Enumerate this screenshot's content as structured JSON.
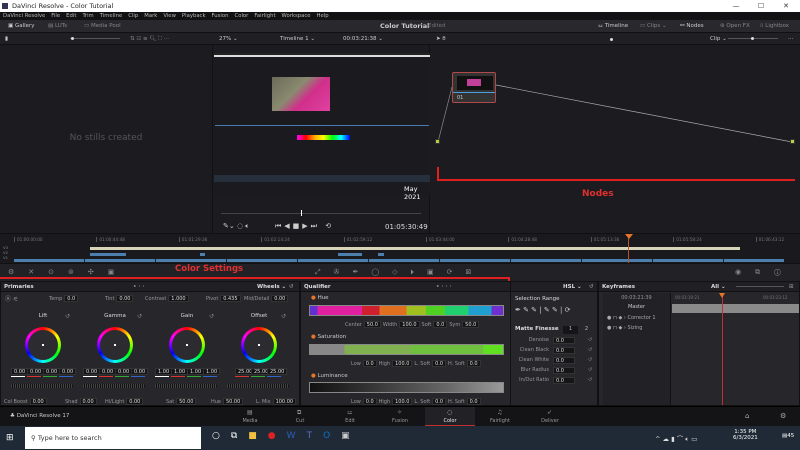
{
  "window": {
    "title": "DaVinci Resolve - Color Tutorial",
    "minimize": "—",
    "maximize": "☐",
    "close": "✕"
  },
  "menu": [
    "DaVinci Resolve",
    "File",
    "Edit",
    "Trim",
    "Timeline",
    "Clip",
    "Mark",
    "View",
    "Playback",
    "Fusion",
    "Color",
    "Fairlight",
    "Workspace",
    "Help"
  ],
  "toolbar": {
    "gallery": "Gallery",
    "luts": "LUTs",
    "media_pool": "Media Pool",
    "project": "Color Tutorial",
    "status": "Edited",
    "timeline": "Timeline",
    "clips": "Clips",
    "nodes": "Nodes",
    "openfx": "Open FX",
    "lightbox": "Lightbox"
  },
  "viewer": {
    "zoom": "27%",
    "timeline_name": "Timeline 1",
    "timecode": "00:03:21:38",
    "playhead_tc": "01:05:30:49",
    "overlay_date": "May 2021"
  },
  "nodes_bar": {
    "mode": "Clip"
  },
  "gallery": {
    "empty": "No stills created"
  },
  "node": {
    "label": "01"
  },
  "annotations": {
    "nodes": "Nodes",
    "color_settings": "Color Settings"
  },
  "timeline": {
    "ruler": [
      "01:00:00:00",
      "01:00:44:48",
      "01:01:29:36",
      "01:02:14:24",
      "01:02:59:12",
      "01:03:44:00",
      "01:04:28:48",
      "01:05:13:36",
      "01:05:58:24",
      "01:06:43:12"
    ],
    "tracks": [
      "V3",
      "V2",
      "V1"
    ]
  },
  "primaries": {
    "title": "Primaries",
    "mode": "Wheels",
    "temp_label": "Temp",
    "temp": "0.0",
    "tint_label": "Tint",
    "tint": "0.00",
    "contrast_label": "Contrast",
    "contrast": "1.000",
    "pivot_label": "Pivot",
    "pivot": "0.435",
    "md_label": "Mid/Detail",
    "md": "0.00",
    "wheels": [
      {
        "name": "Lift",
        "vals": [
          "0.00",
          "0.00",
          "0.00",
          "0.00"
        ]
      },
      {
        "name": "Gamma",
        "vals": [
          "0.00",
          "0.00",
          "0.00",
          "0.00"
        ]
      },
      {
        "name": "Gain",
        "vals": [
          "1.00",
          "1.00",
          "1.00",
          "1.00"
        ]
      },
      {
        "name": "Offset",
        "vals": [
          "25.00",
          "25.00",
          "25.00"
        ]
      }
    ],
    "colboost_label": "Col Boost",
    "colboost": "0.00",
    "shad_label": "Shad",
    "shad": "0.00",
    "hl_label": "Hi/Light",
    "hl": "0.00",
    "sat_label": "Sat",
    "sat": "50.00",
    "hue_label": "Hue",
    "hue": "50.00",
    "lmix_label": "L. Mix",
    "lmix": "100.00"
  },
  "qualifier": {
    "title": "Qualifier",
    "mode": "HSL",
    "hue": "Hue",
    "center_label": "Center",
    "center": "50.0",
    "width_label": "Width",
    "width": "100.0",
    "soft_label": "Soft",
    "soft": "0.0",
    "sym_label": "Sym",
    "sym": "50.0",
    "saturation": "Saturation",
    "luminance": "Luminance",
    "low_label": "Low",
    "low": "0.0",
    "high_label": "High",
    "high": "100.0",
    "lsoft_label": "L. Soft",
    "lsoft": "0.0",
    "hsoft_label": "H. Soft",
    "hsoft": "0.0"
  },
  "selection": {
    "title": "Selection Range",
    "matte": "Matte Finesse",
    "tab1": "1",
    "tab2": "2",
    "rows": [
      {
        "label": "Denoise",
        "value": "0.0"
      },
      {
        "label": "Clean Black",
        "value": "0.0"
      },
      {
        "label": "Clean White",
        "value": "0.0"
      },
      {
        "label": "Blur Radius",
        "value": "0.0"
      },
      {
        "label": "In/Out Ratio",
        "value": "0.0"
      }
    ]
  },
  "keyframes": {
    "title": "Keyframes",
    "filter": "All",
    "tc": "00:03:21:39",
    "t1": "00:03:19:21",
    "t2": "00:03:23:12",
    "master": "Master",
    "rows": [
      "Corrector 1",
      "Sizing"
    ]
  },
  "pages": {
    "app": "DaVinci Resolve 17",
    "tabs": [
      "Media",
      "Cut",
      "Edit",
      "Fusion",
      "Color",
      "Fairlight",
      "Deliver"
    ],
    "active": "Color"
  },
  "taskbar": {
    "search_placeholder": "Type here to search",
    "time": "1:35 PM",
    "date": "6/3/2021",
    "notif": "45"
  },
  "colors": {
    "accent_red": "#e02020",
    "playhead": "#e8742a",
    "clip_blue": "#4d7fae"
  }
}
